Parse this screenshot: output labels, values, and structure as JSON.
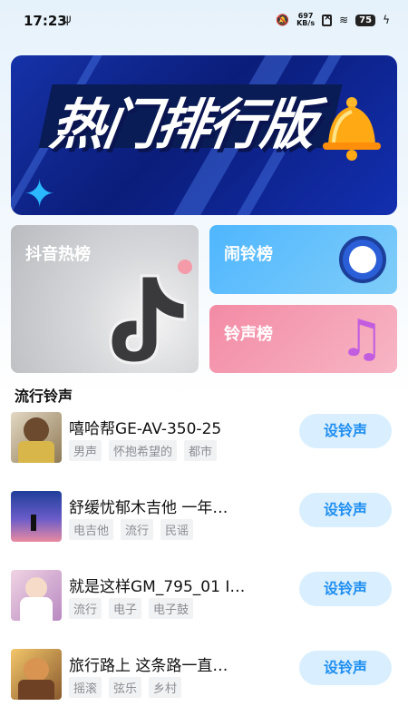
{
  "status_bar": {
    "time": "17:23",
    "usb": "⚡",
    "net_speed_value": "697",
    "net_speed_unit": "KB/s",
    "battery": "75"
  },
  "banner": {
    "title": "热门排行版",
    "page_count": 3,
    "active_page": 1
  },
  "cards": {
    "douyin": {
      "label": "抖音热榜"
    },
    "alarm": {
      "label": "闹铃榜"
    },
    "ringtone": {
      "label": "铃声榜"
    }
  },
  "section_title": "流行铃声",
  "songs": [
    {
      "title": "嘻哈帮GE-AV-350-25",
      "tags": [
        "男声",
        "怀抱希望的",
        "都市"
      ],
      "button": "设铃声",
      "thumb_color": "#c9b79a"
    },
    {
      "title": "舒缓忧郁木吉他 一年…",
      "tags": [
        "电吉他",
        "流行",
        "民谣"
      ],
      "button": "设铃声",
      "thumb_color": "#2c5fb8"
    },
    {
      "title": "就是这样GM_795_01 I…",
      "tags": [
        "流行",
        "电子",
        "电子鼓"
      ],
      "button": "设铃声",
      "thumb_color": "#d6a8c8"
    },
    {
      "title": "旅行路上 这条路一直…",
      "tags": [
        "摇滚",
        "弦乐",
        "乡村"
      ],
      "button": "设铃声",
      "thumb_color": "#a87848"
    }
  ]
}
